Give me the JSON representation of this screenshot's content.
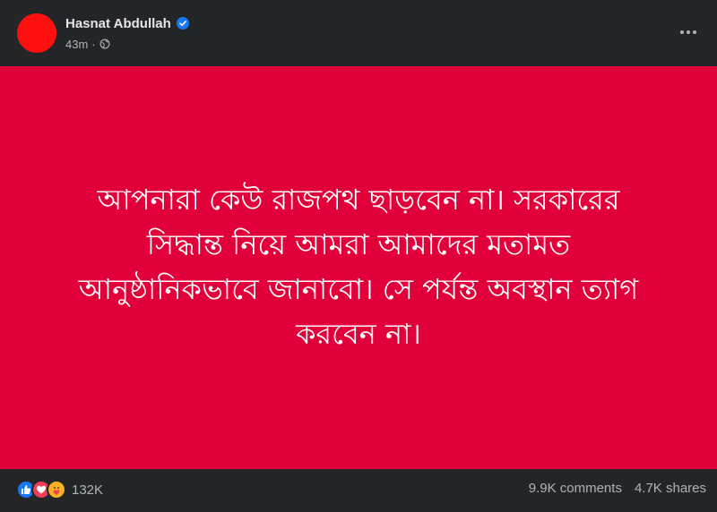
{
  "header": {
    "author": "Hasnat Abdullah",
    "timestamp": "43m",
    "separator": "·",
    "verified_icon": "verified-badge-icon",
    "privacy_icon": "globe-icon",
    "more_icon": "more-horizontal-icon"
  },
  "media": {
    "background_color": "#e2003a",
    "text_color": "#ffffff",
    "lines": [
      "আপনারা কেউ রাজপথ ছাড়বেন না। সরকারের",
      "সিদ্ধান্ত নিয়ে আমরা আমাদের মতামত",
      "আনুষ্ঠানিকভাবে জানাবো। সে পর্যন্ত অবস্থান ত্যাগ",
      "করবেন না।"
    ]
  },
  "footer": {
    "reaction_icons": [
      "like-icon",
      "love-icon",
      "care-icon"
    ],
    "reaction_count": "132K",
    "comments": "9.9K comments",
    "shares": "4.7K shares"
  },
  "colors": {
    "card_bg": "#242526",
    "avatar": "#ff1010",
    "verified": "#1877f2",
    "secondary_text": "#b0b3b8"
  }
}
